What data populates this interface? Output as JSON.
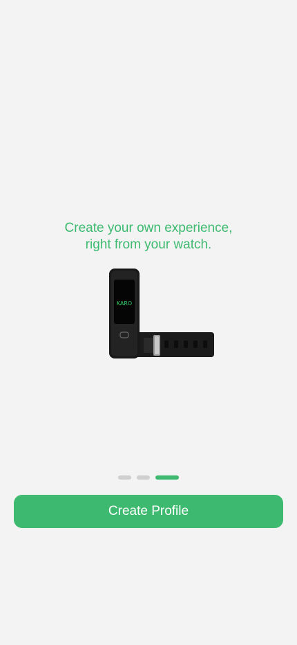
{
  "onboarding": {
    "headline_line1": "Create your own experience,",
    "headline_line2": "right from your watch.",
    "watch_brand": "KARO",
    "pager": {
      "total": 3,
      "active_index": 2
    },
    "cta_label": "Create Profile"
  },
  "colors": {
    "accent": "#3dba6f",
    "background": "#f3f3f3",
    "pager_inactive": "#cfcfcf",
    "button_text": "#ffffff"
  }
}
